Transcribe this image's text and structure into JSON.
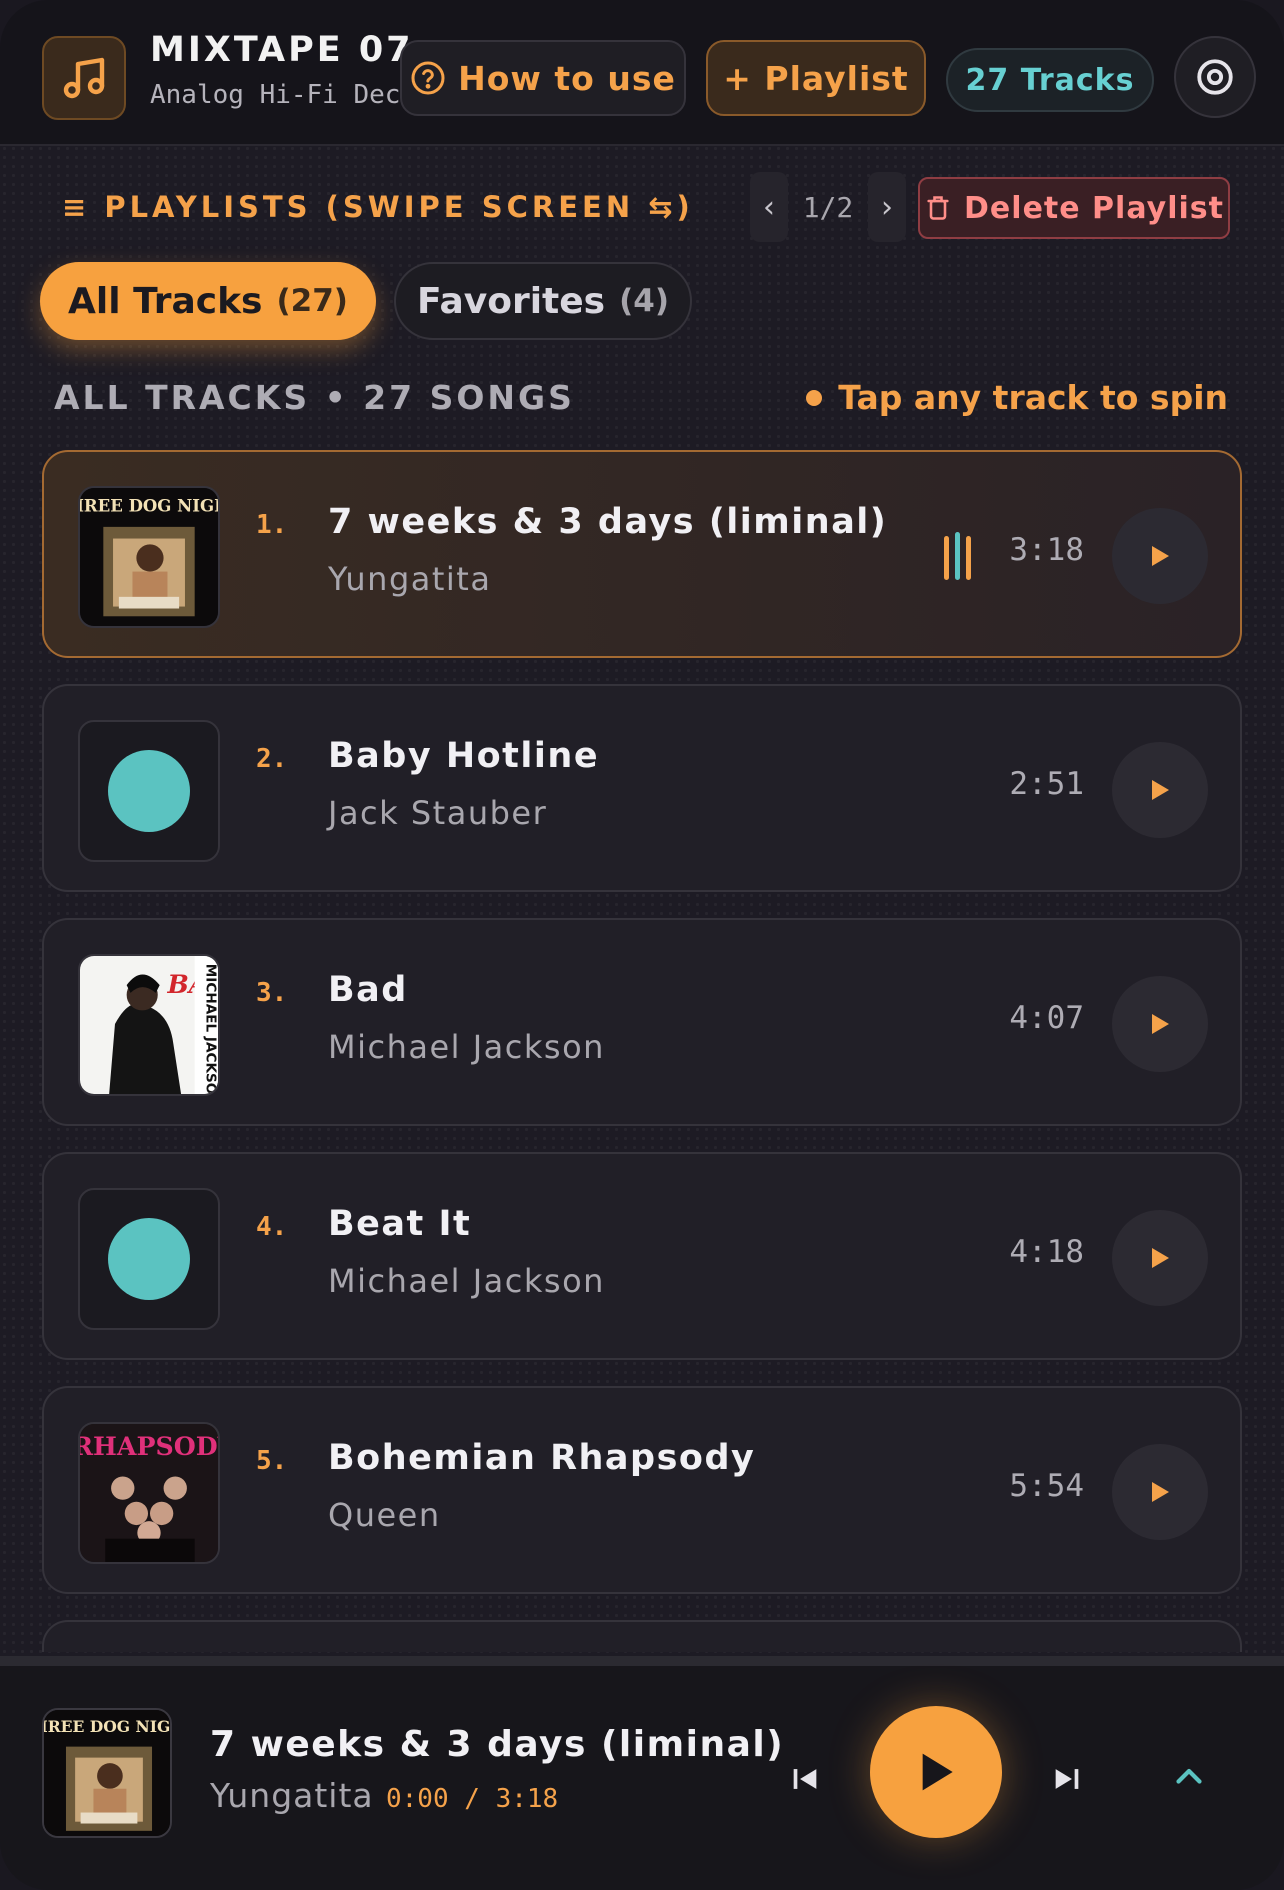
{
  "header": {
    "title": "MIXTAPE 07",
    "subtitle": "Analog Hi-Fi Deck",
    "how_to_use": "How to use",
    "add_playlist": "+ Playlist",
    "tracks_badge": "27 Tracks",
    "logo_icon": "music-note-icon",
    "settings_icon": "settings-icon"
  },
  "playlists": {
    "label": "PLAYLISTS (SWIPE SCREEN ⇆)",
    "page_indicator": "1/2",
    "delete_label": "Delete Playlist",
    "tabs": [
      {
        "label": "All Tracks",
        "count": "(27)",
        "active": true
      },
      {
        "label": "Favorites",
        "count": "(4)",
        "active": false
      }
    ]
  },
  "section": {
    "title": "ALL TRACKS • 27 SONGS",
    "hint": "Tap any track to spin"
  },
  "tracks": [
    {
      "number": "1.",
      "title": "7 weeks & 3 days (liminal)",
      "artist": "Yungatita",
      "duration": "3:18",
      "art": "album-cover",
      "playing": true
    },
    {
      "number": "2.",
      "title": "Baby Hotline",
      "artist": "Jack Stauber",
      "duration": "2:51",
      "art": "placeholder-disc"
    },
    {
      "number": "3.",
      "title": "Bad",
      "artist": "Michael Jackson",
      "duration": "4:07",
      "art": "album-cover"
    },
    {
      "number": "4.",
      "title": "Beat It",
      "artist": "Michael Jackson",
      "duration": "4:18",
      "art": "placeholder-disc"
    },
    {
      "number": "5.",
      "title": "Bohemian Rhapsody",
      "artist": "Queen",
      "duration": "5:54",
      "art": "album-cover"
    }
  ],
  "player": {
    "title": "7 weeks & 3 days (liminal)",
    "artist": "Yungatita",
    "time": "0:00 / 3:18"
  },
  "colors": {
    "accent": "#f7a13f",
    "teal": "#5bc3c1",
    "danger": "#ff8e89",
    "background": "#1d1b24"
  }
}
